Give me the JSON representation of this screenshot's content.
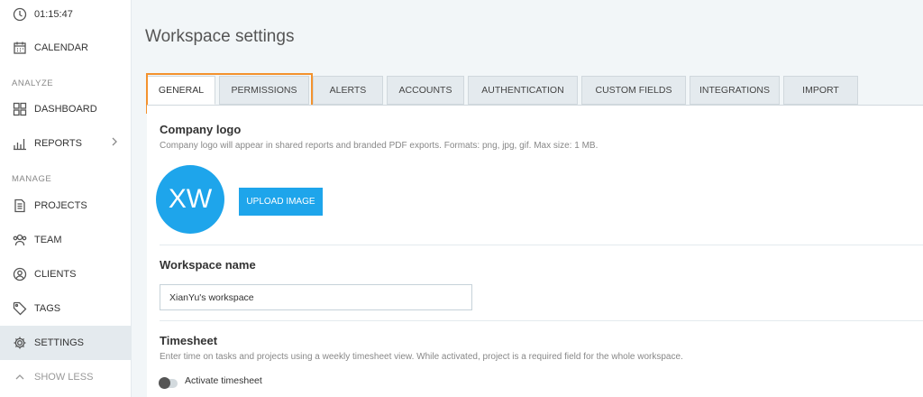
{
  "sidebar": {
    "timer": "01:15:47",
    "calendar": "CALENDAR",
    "analyze_section": "ANALYZE",
    "dashboard": "DASHBOARD",
    "reports": "REPORTS",
    "manage_section": "MANAGE",
    "projects": "PROJECTS",
    "team": "TEAM",
    "clients": "CLIENTS",
    "tags": "TAGS",
    "settings": "SETTINGS",
    "show_less": "SHOW LESS",
    "active_item": "SETTINGS"
  },
  "page": {
    "title": "Workspace settings"
  },
  "tabs": {
    "general": "GENERAL",
    "permissions": "PERMISSIONS",
    "alerts": "ALERTS",
    "accounts": "ACCOUNTS",
    "authentication": "AUTHENTICATION",
    "custom_fields": "CUSTOM FIELDS",
    "integrations": "INTEGRATIONS",
    "import": "IMPORT",
    "active": "GENERAL"
  },
  "logo": {
    "title": "Company logo",
    "description": "Company logo will appear in shared reports and branded PDF exports. Formats: png, jpg, gif. Max size: 1 MB.",
    "avatar_initials": "XW",
    "upload_label": "UPLOAD IMAGE"
  },
  "workspace_name": {
    "title": "Workspace name",
    "value": "XianYu's workspace"
  },
  "timesheet": {
    "title": "Timesheet",
    "description": "Enter time on tasks and projects using a weekly timesheet view. While activated, project is a required field for the whole workspace.",
    "toggle_label": "Activate timesheet",
    "toggle_on": false
  },
  "colors": {
    "accent": "#1ea5eb",
    "highlight": "#f3922e",
    "sidebar_active": "#e4eaee",
    "background": "#f2f6f8"
  }
}
